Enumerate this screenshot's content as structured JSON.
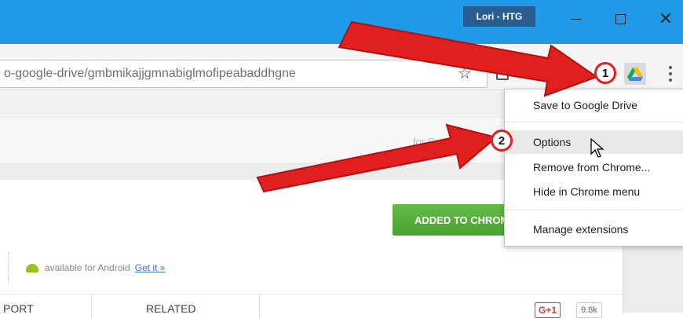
{
  "titlebar": {
    "profile": "Lori - HTG",
    "color": "#1f9ae8"
  },
  "toolbar": {
    "url_text": "o-google-drive/gmbmikajjgmnabiglmofipeabaddhgne",
    "star_glyph": "☆"
  },
  "search_hint": "for Google",
  "store": {
    "added_button_label": "ADDED TO CHROME",
    "android_text": "available for Android",
    "get_it_link": "Get it »",
    "tab_support": "PORT",
    "tab_related": "RELATED",
    "gplus_label": "G+1",
    "gplus_count": "9.8k",
    "accent_green": "#5cb23f"
  },
  "context_menu": {
    "items": [
      {
        "label": "Save to Google Drive",
        "highlighted": false
      },
      {
        "label": "Options",
        "highlighted": true
      },
      {
        "label": "Remove from Chrome...",
        "highlighted": false
      },
      {
        "label": "Hide in Chrome menu",
        "highlighted": false
      },
      {
        "label": "Manage extensions",
        "highlighted": false
      }
    ]
  },
  "annotations": {
    "badge_1": "1",
    "badge_2": "2",
    "arrow_color": "#e01f1f"
  },
  "icons": [
    "star-icon",
    "cast-icon",
    "extension-icon",
    "google-drive-icon",
    "more-vert-icon",
    "android-icon",
    "mouse-cursor-icon"
  ]
}
